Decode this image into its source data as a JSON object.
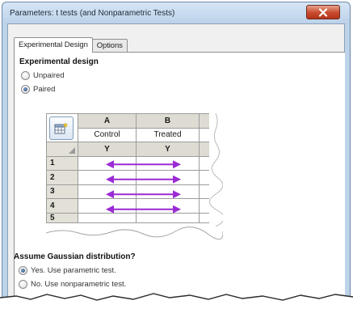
{
  "window": {
    "title": "Parameters: t tests (and Nonparametric Tests)"
  },
  "tabs": [
    {
      "label": "Experimental Design",
      "active": true
    },
    {
      "label": "Options",
      "active": false
    }
  ],
  "experimental_design": {
    "heading": "Experimental design",
    "options": [
      {
        "label": "Unpaired",
        "selected": false
      },
      {
        "label": "Paired",
        "selected": true
      }
    ]
  },
  "table": {
    "columns": [
      {
        "letter": "A",
        "title": "Control",
        "subheader": "Y"
      },
      {
        "letter": "B",
        "title": "Treated",
        "subheader": "Y"
      }
    ],
    "rows": [
      "1",
      "2",
      "3",
      "4",
      "5"
    ]
  },
  "gaussian": {
    "heading": "Assume Gaussian distribution?",
    "options": [
      {
        "label": "Yes. Use parametric test.",
        "selected": true
      },
      {
        "label": "No. Use nonparametric test.",
        "selected": false
      }
    ]
  },
  "colors": {
    "arrow": "#9b2bd4",
    "close_button": "#c84a2d",
    "title_bar": "#bcd3ea"
  },
  "icons": {
    "close": "close-icon",
    "new_table": "new-table-icon"
  }
}
